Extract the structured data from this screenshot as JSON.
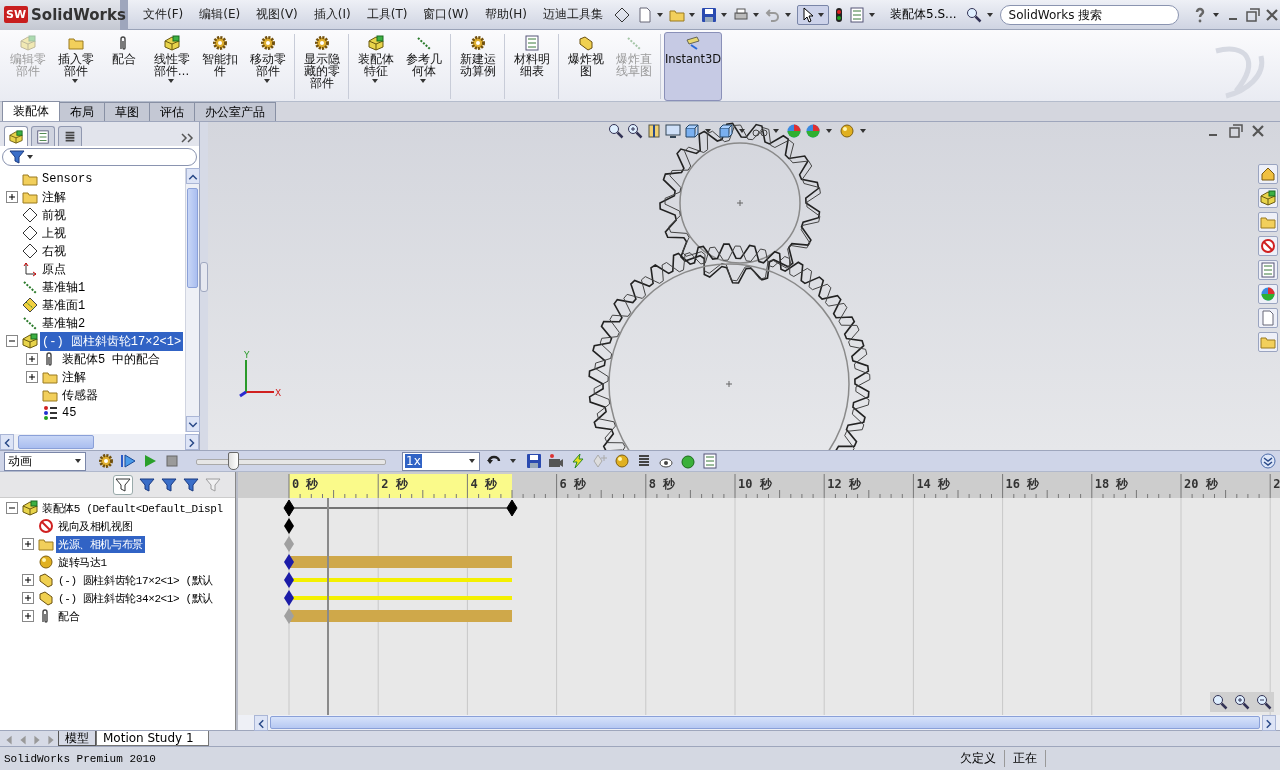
{
  "title_bar": {
    "logo_text": "SW",
    "app_name": "SolidWorks",
    "menus": [
      "文件(F)",
      "编辑(E)",
      "视图(V)",
      "插入(I)",
      "工具(T)",
      "窗口(W)",
      "帮助(H)",
      "迈迪工具集"
    ],
    "document_title": "装配体5.S...",
    "search": {
      "placeholder": "SolidWorks 搜索"
    }
  },
  "ribbon": {
    "groups": [
      [
        {
          "label": "编辑零部件",
          "disabled": true,
          "dropdown": false,
          "pressed": false
        },
        {
          "label": "插入零部件",
          "disabled": false,
          "dropdown": true,
          "pressed": false
        },
        {
          "label": "配合",
          "disabled": false,
          "dropdown": false,
          "pressed": false
        },
        {
          "label": "线性零部件…",
          "disabled": false,
          "dropdown": true,
          "pressed": false
        },
        {
          "label": "智能扣件",
          "disabled": false,
          "dropdown": false,
          "pressed": false
        },
        {
          "label": "移动零部件",
          "disabled": false,
          "dropdown": true,
          "pressed": false
        }
      ],
      [
        {
          "label": "显示隐藏的零部件",
          "disabled": false,
          "dropdown": false,
          "pressed": false
        }
      ],
      [
        {
          "label": "装配体特征",
          "disabled": false,
          "dropdown": true,
          "pressed": false
        },
        {
          "label": "参考几何体",
          "disabled": false,
          "dropdown": true,
          "pressed": false
        }
      ],
      [
        {
          "label": "新建运动算例",
          "disabled": false,
          "dropdown": false,
          "pressed": false
        }
      ],
      [
        {
          "label": "材料明细表",
          "disabled": false,
          "dropdown": false,
          "pressed": false
        }
      ],
      [
        {
          "label": "爆炸视图",
          "disabled": false,
          "dropdown": false,
          "pressed": false
        },
        {
          "label": "爆炸直线草图",
          "disabled": true,
          "dropdown": false,
          "pressed": false
        }
      ],
      [
        {
          "label": "Instant3D",
          "disabled": false,
          "dropdown": false,
          "pressed": true
        }
      ]
    ]
  },
  "command_tabs": [
    {
      "label": "装配体",
      "selected": true
    },
    {
      "label": "布局",
      "selected": false
    },
    {
      "label": "草图",
      "selected": false
    },
    {
      "label": "评估",
      "selected": false
    },
    {
      "label": "办公室产品",
      "selected": false
    }
  ],
  "feature_tree": {
    "items": [
      {
        "label": "Sensors",
        "selected": false
      },
      {
        "label": "注解",
        "selected": false,
        "expanded": false
      },
      {
        "label": "前视",
        "selected": false
      },
      {
        "label": "上视",
        "selected": false
      },
      {
        "label": "右视",
        "selected": false
      },
      {
        "label": "原点",
        "selected": false
      },
      {
        "label": "基准轴1",
        "selected": false
      },
      {
        "label": "基准面1",
        "selected": false
      },
      {
        "label": "基准轴2",
        "selected": false
      },
      {
        "label": "(-) 圆柱斜齿轮17×2<1>",
        "selected": true,
        "expanded": true,
        "children": [
          {
            "label": "装配体5 中的配合",
            "selected": false,
            "expanded": false
          },
          {
            "label": "注解",
            "selected": false,
            "expanded": false
          },
          {
            "label": "传感器",
            "selected": false
          },
          {
            "label": "45",
            "selected": false
          }
        ]
      }
    ]
  },
  "graphics": {
    "axis_labels": {
      "y": "Y",
      "x": "X"
    }
  },
  "motion": {
    "study_type": "动画",
    "playback_speed": "1x",
    "slider": {
      "level": 0.19
    },
    "tree": [
      {
        "label": "装配体5 (Default<Default_Displ",
        "selected": false,
        "expanded": true,
        "track": {
          "kind": "span",
          "color": "#000000"
        },
        "children": [
          {
            "label": "视向及相机视图",
            "selected": false,
            "track": {
              "kind": "key",
              "color": "#000000"
            }
          },
          {
            "label": "光源、相机与布景",
            "selected": true,
            "expanded": false,
            "track": {
              "kind": "key",
              "color": "#a0a0a0"
            }
          },
          {
            "label": "旋转马达1",
            "selected": false,
            "track": {
              "kind": "bar",
              "color": "#1c1ca8"
            }
          },
          {
            "label": "(-) 圆柱斜齿轮17×2<1> (默认",
            "selected": false,
            "expanded": false,
            "track": {
              "kind": "line",
              "color": "#1c1ca8"
            }
          },
          {
            "label": "(-) 圆柱斜齿轮34×2<1> (默认",
            "selected": false,
            "expanded": false,
            "track": {
              "kind": "line",
              "color": "#1c1ca8"
            }
          },
          {
            "label": "配合",
            "selected": false,
            "expanded": false,
            "track": {
              "kind": "bar",
              "color": "#a0a0a0"
            }
          }
        ]
      }
    ],
    "ticks": [
      "0 秒",
      "2 秒",
      "4 秒",
      "6 秒",
      "8 秒",
      "10 秒",
      "12 秒",
      "14 秒",
      "16 秒",
      "18 秒",
      "20 秒",
      "2"
    ]
  },
  "bottom_tabs": [
    {
      "label": "模型",
      "selected": false
    },
    {
      "label": "Motion Study 1",
      "selected": true
    }
  ],
  "status_bar": {
    "product": "SolidWorks Premium 2010",
    "fields": [
      "欠定义",
      "正在"
    ]
  }
}
